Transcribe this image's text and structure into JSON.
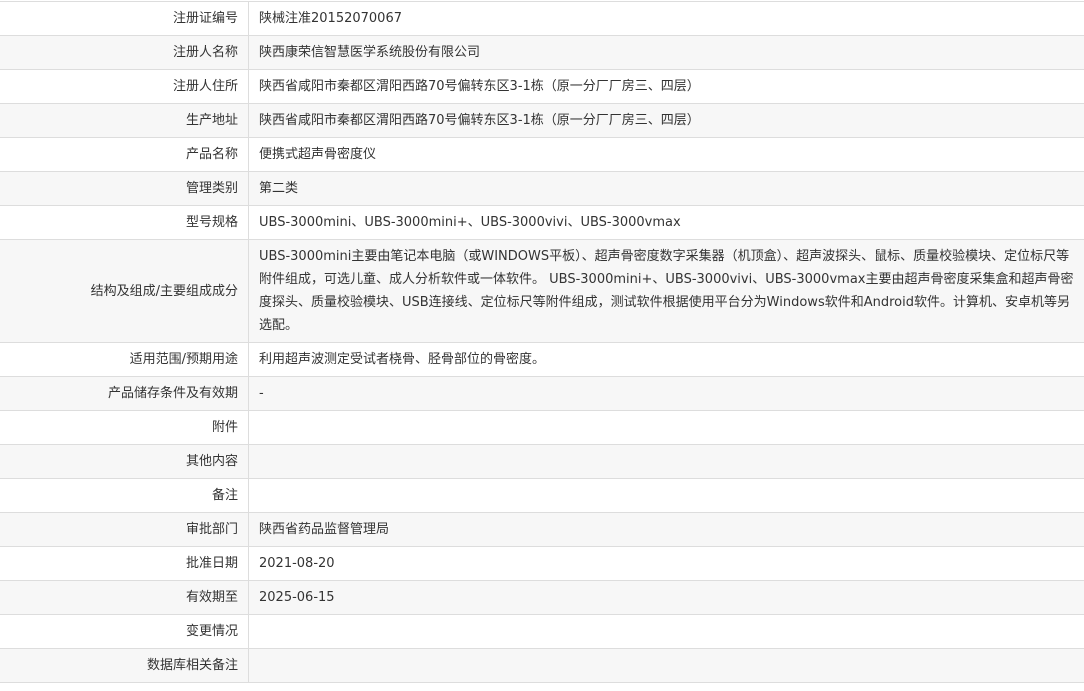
{
  "rows": [
    {
      "label": "注册证编号",
      "value": "陕械注准20152070067"
    },
    {
      "label": "注册人名称",
      "value": "陕西康荣信智慧医学系统股份有限公司"
    },
    {
      "label": "注册人住所",
      "value": "陕西省咸阳市秦都区渭阳西路70号偏转东区3-1栋（原一分厂厂房三、四层）"
    },
    {
      "label": "生产地址",
      "value": "陕西省咸阳市秦都区渭阳西路70号偏转东区3-1栋（原一分厂厂房三、四层）"
    },
    {
      "label": "产品名称",
      "value": "便携式超声骨密度仪"
    },
    {
      "label": "管理类别",
      "value": "第二类"
    },
    {
      "label": "型号规格",
      "value": "UBS-3000mini、UBS-3000mini+、UBS-3000vivi、UBS-3000vmax"
    },
    {
      "label": "结构及组成/主要组成成分",
      "value": "UBS-3000mini主要由笔记本电脑（或WINDOWS平板）、超声骨密度数字采集器（机顶盒）、超声波探头、鼠标、质量校验模块、定位标尺等附件组成，可选儿童、成人分析软件或一体软件。 UBS-3000mini+、UBS-3000vivi、UBS-3000vmax主要由超声骨密度采集盒和超声骨密度探头、质量校验模块、USB连接线、定位标尺等附件组成，测试软件根据使用平台分为Windows软件和Android软件。计算机、安卓机等另选配。"
    },
    {
      "label": "适用范围/预期用途",
      "value": "利用超声波测定受试者桡骨、胫骨部位的骨密度。"
    },
    {
      "label": "产品储存条件及有效期",
      "value": "-"
    },
    {
      "label": "附件",
      "value": ""
    },
    {
      "label": "其他内容",
      "value": ""
    },
    {
      "label": "备注",
      "value": ""
    },
    {
      "label": "审批部门",
      "value": "陕西省药品监督管理局"
    },
    {
      "label": "批准日期",
      "value": "2021-08-20"
    },
    {
      "label": "有效期至",
      "value": "2025-06-15"
    },
    {
      "label": "变更情况",
      "value": ""
    },
    {
      "label": "数据库相关备注",
      "value": ""
    }
  ]
}
